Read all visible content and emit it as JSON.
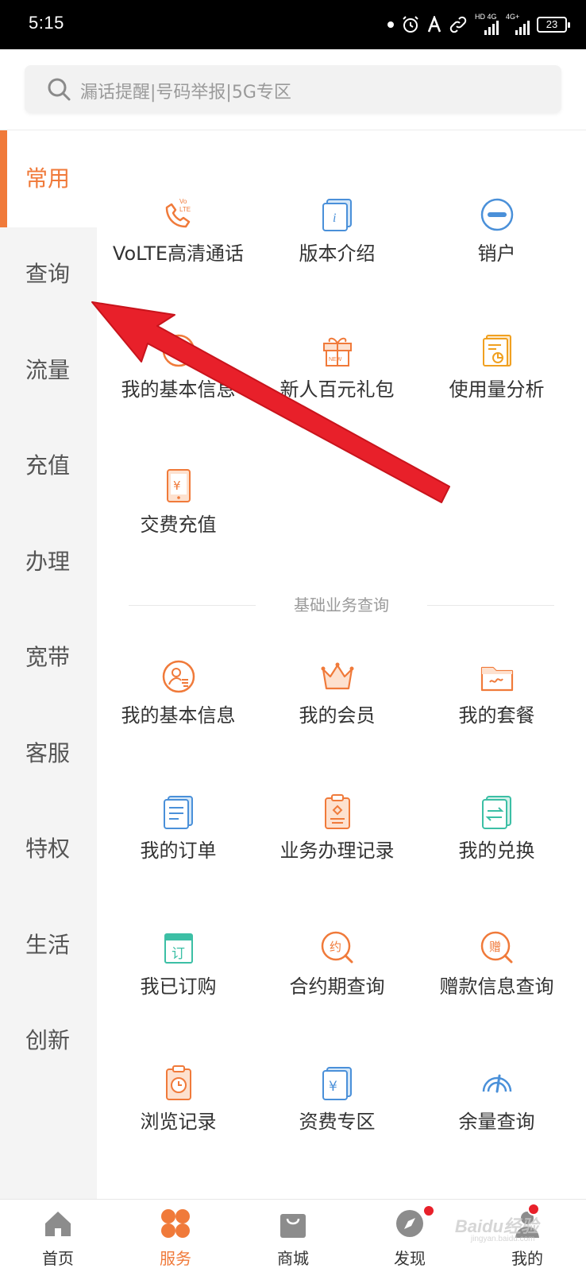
{
  "status_bar": {
    "time": "5:15",
    "network_1": "HD 4G",
    "network_2": "4G+",
    "battery": "23"
  },
  "search": {
    "placeholder": "漏话提醒|号码举报|5G专区"
  },
  "sidebar": {
    "items": [
      {
        "label": "常用",
        "active": true
      },
      {
        "label": "查询"
      },
      {
        "label": "流量"
      },
      {
        "label": "充值"
      },
      {
        "label": "办理"
      },
      {
        "label": "宽带"
      },
      {
        "label": "客服"
      },
      {
        "label": "特权"
      },
      {
        "label": "生活"
      },
      {
        "label": "创新"
      }
    ]
  },
  "common": {
    "items": [
      {
        "label": "VoLTE高清通话",
        "icon": "volte-phone-icon"
      },
      {
        "label": "版本介绍",
        "icon": "info-card-icon"
      },
      {
        "label": "销户",
        "icon": "minus-circle-icon"
      },
      {
        "label": "我的基本信息",
        "icon": "clock-circle-icon"
      },
      {
        "label": "新人百元礼包",
        "icon": "gift-box-icon"
      },
      {
        "label": "使用量分析",
        "icon": "report-chart-icon"
      },
      {
        "label": "交费充值",
        "icon": "phone-yen-icon"
      }
    ]
  },
  "basic_query": {
    "title": "基础业务查询",
    "items": [
      {
        "label": "我的基本信息",
        "icon": "user-profile-icon"
      },
      {
        "label": "我的会员",
        "icon": "crown-icon"
      },
      {
        "label": "我的套餐",
        "icon": "package-folder-icon"
      },
      {
        "label": "我的订单",
        "icon": "order-list-icon"
      },
      {
        "label": "业务办理记录",
        "icon": "clipboard-record-icon"
      },
      {
        "label": "我的兑换",
        "icon": "exchange-icon"
      },
      {
        "label": "我已订购",
        "icon": "subscribed-icon",
        "glyph": "订"
      },
      {
        "label": "合约期查询",
        "icon": "contract-search-icon",
        "glyph": "约"
      },
      {
        "label": "赠款信息查询",
        "icon": "gift-money-search-icon",
        "glyph": "赠"
      },
      {
        "label": "浏览记录",
        "icon": "history-clipboard-icon"
      },
      {
        "label": "资费专区",
        "icon": "tariff-yen-icon"
      },
      {
        "label": "余量查询",
        "icon": "balance-gauge-icon"
      }
    ]
  },
  "tabbar": {
    "items": [
      {
        "label": "首页",
        "icon": "home-icon"
      },
      {
        "label": "服务",
        "icon": "service-grid-icon",
        "active": true
      },
      {
        "label": "商城",
        "icon": "shopping-bag-icon"
      },
      {
        "label": "发现",
        "icon": "compass-icon",
        "badge": true
      },
      {
        "label": "我的",
        "icon": "user-icon",
        "badge": true
      }
    ]
  },
  "watermark": {
    "text": "Baidu经验",
    "url": "jingyan.baidu.com"
  },
  "colors": {
    "accent": "#f07a3a",
    "arrow": "#e8202a",
    "icon_blue": "#4a90d9",
    "icon_teal": "#3cbfa5"
  }
}
